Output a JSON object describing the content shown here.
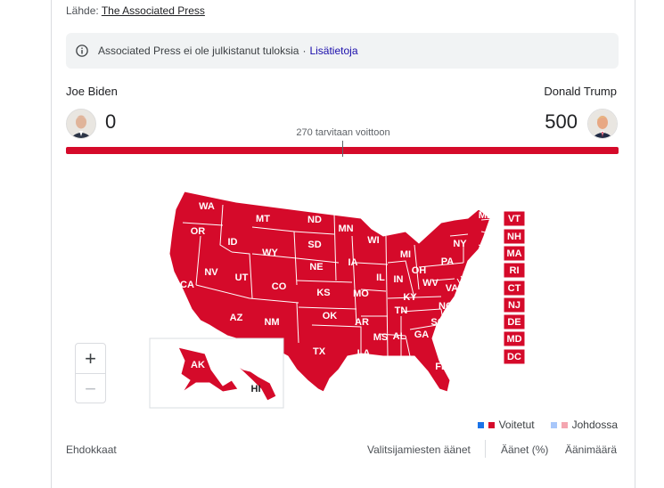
{
  "source": {
    "label": "Lähde:",
    "link": "The Associated Press"
  },
  "notice": {
    "text": "Associated Press ei ole julkistanut tuloksia",
    "sep": "·",
    "link": "Lisätietoja"
  },
  "candidates": [
    {
      "name": "Joe Biden",
      "votes": "0"
    },
    {
      "name": "Donald Trump",
      "votes": "500"
    }
  ],
  "threshold_label": "270 tarvitaan voittoon",
  "progress": {
    "trump_fraction": 1.0
  },
  "colors": {
    "republican": "#d50a2a",
    "democrat": "#1a73e8",
    "rep_leading": "#f4a6b0",
    "dem_leading": "#a8c7fa"
  },
  "map": {
    "states": [
      "WA",
      "OR",
      "CA",
      "ID",
      "NV",
      "MT",
      "WY",
      "UT",
      "AZ",
      "CO",
      "NM",
      "ND",
      "SD",
      "NE",
      "KS",
      "OK",
      "TX",
      "MN",
      "IA",
      "MO",
      "AR",
      "LA",
      "WI",
      "IL",
      "MI",
      "IN",
      "OH",
      "KY",
      "TN",
      "MS",
      "AL",
      "GA",
      "FL",
      "SC",
      "NC",
      "VA",
      "WV",
      "PA",
      "NY",
      "ME",
      "AK",
      "HI"
    ],
    "small_states": [
      "VT",
      "NH",
      "MA",
      "RI",
      "CT",
      "NJ",
      "DE",
      "MD",
      "DC"
    ]
  },
  "zoom": {
    "in": "+",
    "out": "−"
  },
  "legend": {
    "won": "Voitetut",
    "leading": "Johdossa"
  },
  "table_header": {
    "candidates": "Ehdokkaat",
    "electoral": "Valitsijamiesten äänet",
    "percent": "Äänet (%)",
    "count": "Äänimäärä"
  }
}
